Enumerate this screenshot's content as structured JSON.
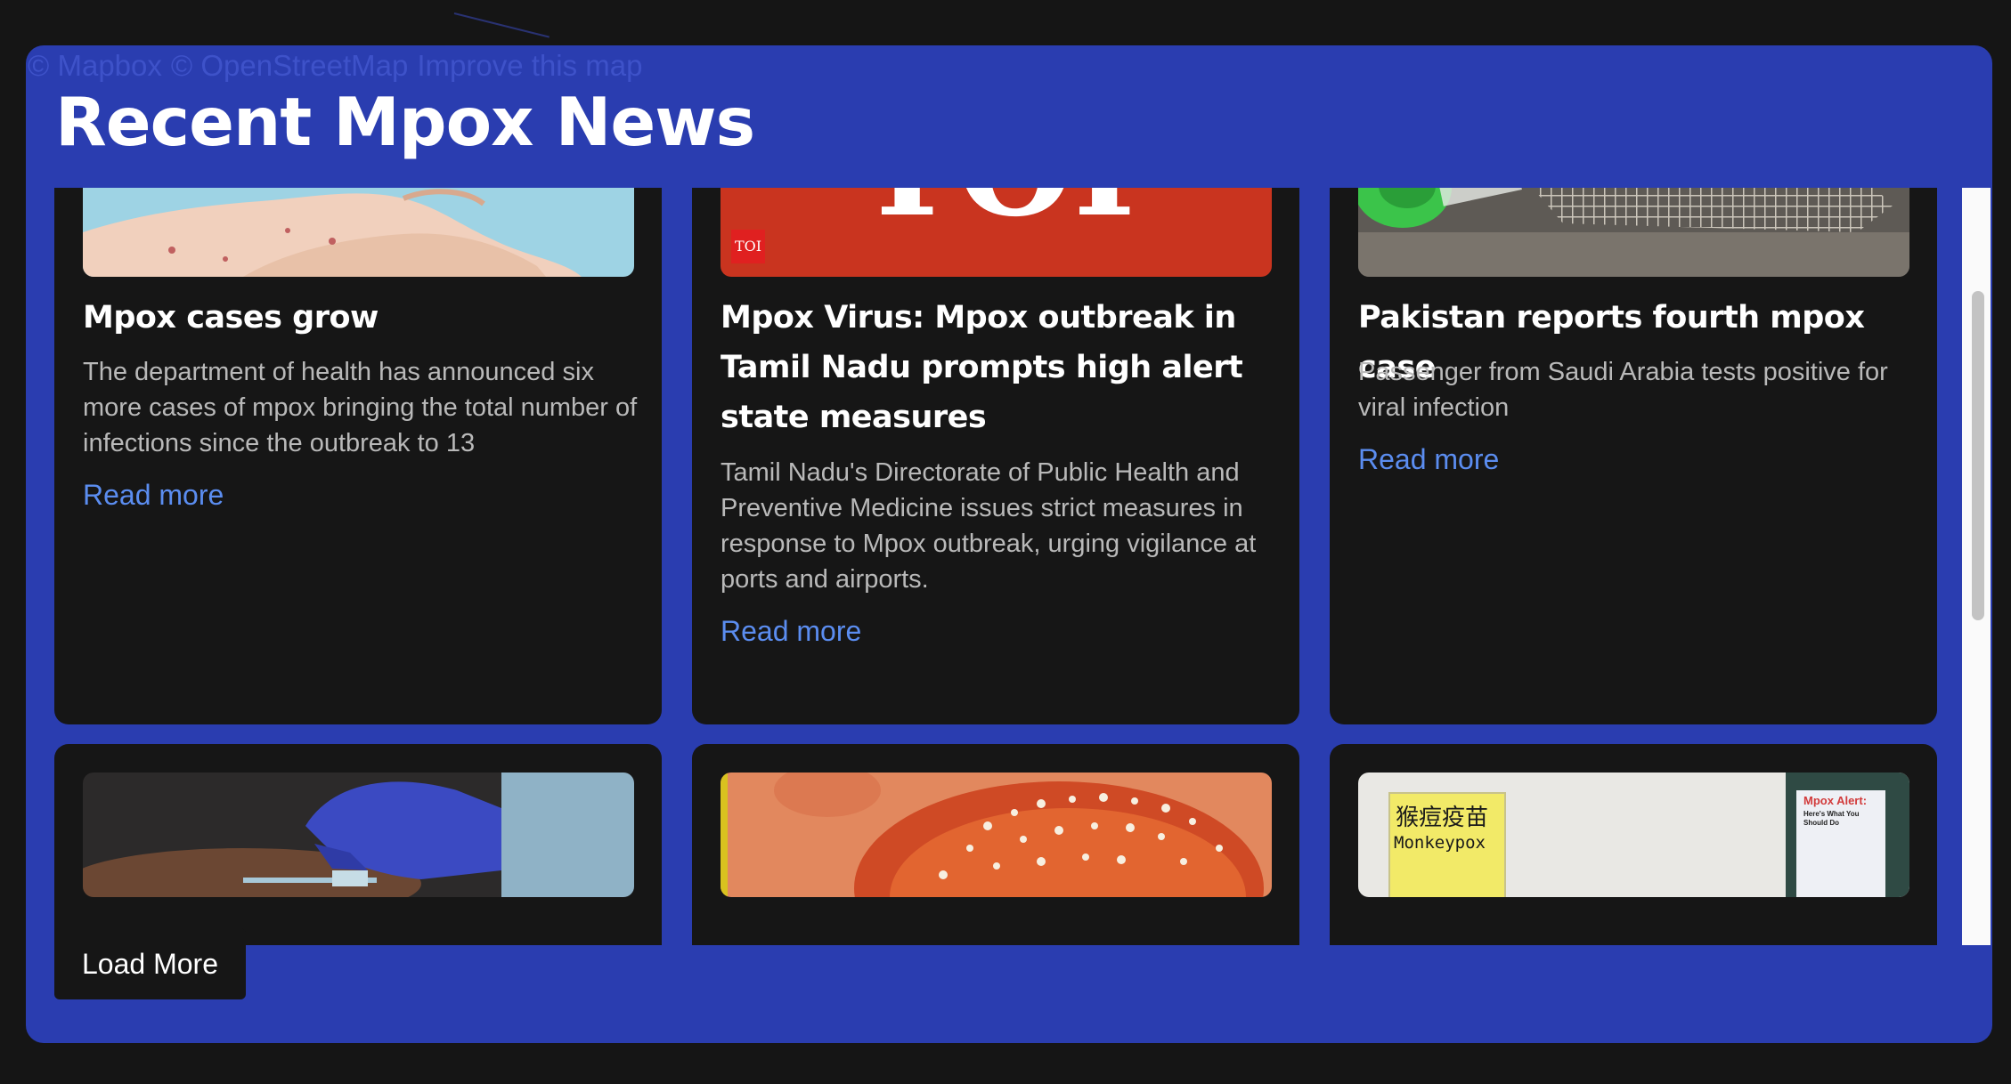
{
  "map_attribution": {
    "mapbox": "© Mapbox",
    "osm": "© OpenStreetMap",
    "improve": "Improve this map"
  },
  "section": {
    "title": "Recent Mpox News"
  },
  "articles": [
    {
      "title": "Mpox cases grow",
      "description": "The department of health has announced six more cases of mpox bringing the total number of infections since the outbreak to 13",
      "link_label": "Read more",
      "image_icon": "hands-rash-photo"
    },
    {
      "title": "Mpox Virus: Mpox outbreak in Tamil Nadu prompts high alert state measures",
      "description": "Tamil Nadu's Directorate of Public Health and Preventive Medicine issues strict measures in response to Mpox outbreak, urging vigilance at ports and airports.",
      "link_label": "Read more",
      "image_icon": "toi-logo",
      "image_text": "TOI",
      "image_badge": "TOI"
    },
    {
      "title": "Pakistan reports fourth mpox case",
      "description": "Passenger from Saudi Arabia tests positive for viral infection",
      "link_label": "Read more",
      "image_icon": "sample-tube-photo"
    },
    {
      "image_icon": "vaccine-injection-photo"
    },
    {
      "image_icon": "virus-particle-photo"
    },
    {
      "image_icon": "vaccine-sign-photo",
      "image_sign_cn": "猴痘疫苗",
      "image_sign_en": "Monkeypox",
      "image_poster_title": "Mpox Alert:",
      "image_poster_sub": "Here's What You Should Do"
    }
  ],
  "load_more_label": "Load More",
  "colors": {
    "panel_bg": "#2a3db0",
    "card_bg": "#161616",
    "link": "#5b8df0",
    "page_bg": "#151515"
  }
}
